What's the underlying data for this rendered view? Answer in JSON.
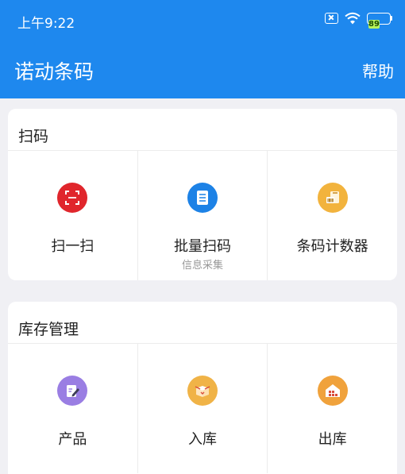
{
  "status": {
    "time": "上午9:22",
    "battery": "89",
    "sim_icon": "sim-off-icon",
    "wifi_icon": "wifi-icon"
  },
  "appbar": {
    "title": "诺动条码",
    "help": "帮助"
  },
  "sections": {
    "scan": {
      "title": "扫码",
      "items": [
        {
          "label": "扫一扫",
          "icon": "scan-frame-icon",
          "color": "#e0262c"
        },
        {
          "label": "批量扫码",
          "sub": "信息采集",
          "icon": "document-list-icon",
          "color": "#1d82e6"
        },
        {
          "label": "条码计数器",
          "icon": "barcode-counter-icon",
          "color": "#f2b33d"
        }
      ]
    },
    "stock": {
      "title": "库存管理",
      "items": [
        {
          "label": "产品",
          "icon": "product-edit-icon",
          "color": "#9a7ee3"
        },
        {
          "label": "入库",
          "icon": "stock-in-box-icon",
          "color": "#f0b347"
        },
        {
          "label": "出库",
          "icon": "warehouse-out-icon",
          "color": "#f0a23c"
        }
      ]
    }
  },
  "colors": {
    "primary": "#1e88ee",
    "background": "#f0f0f4"
  }
}
